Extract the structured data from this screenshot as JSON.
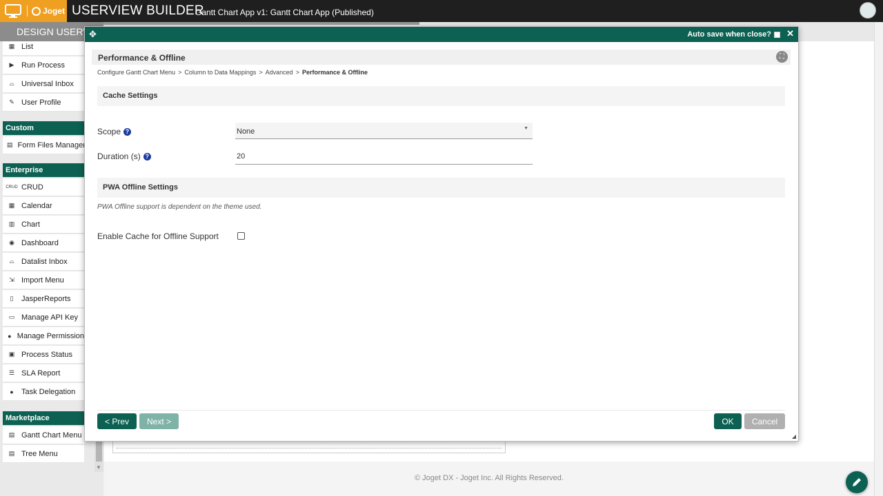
{
  "header": {
    "logo_text": "Joget",
    "title": "USERVIEW BUILDER",
    "subtitle": "Gantt Chart App v1: Gantt Chart App (Published)"
  },
  "subbar": {
    "design_tab": "DESIGN USERVIEW"
  },
  "sidebar": {
    "items_top": [
      {
        "label": "List",
        "icon": "table-icon"
      },
      {
        "label": "Run Process",
        "icon": "play-icon"
      },
      {
        "label": "Universal Inbox",
        "icon": "inbox-icon"
      },
      {
        "label": "User Profile",
        "icon": "user-edit-icon"
      }
    ],
    "custom_heading": "Custom",
    "custom_items": [
      {
        "label": "Form Files Manager",
        "icon": "plugin-icon"
      }
    ],
    "enterprise_heading": "Enterprise",
    "enterprise_items": [
      {
        "label": "CRUD",
        "icon": "crud-icon"
      },
      {
        "label": "Calendar",
        "icon": "calendar-icon"
      },
      {
        "label": "Chart",
        "icon": "chart-icon"
      },
      {
        "label": "Dashboard",
        "icon": "dashboard-icon"
      },
      {
        "label": "Datalist Inbox",
        "icon": "inbox-icon"
      },
      {
        "label": "Import Menu",
        "icon": "import-icon"
      },
      {
        "label": "JasperReports",
        "icon": "report-icon"
      },
      {
        "label": "Manage API Key",
        "icon": "desktop-icon"
      },
      {
        "label": "Manage Permission",
        "icon": "users-icon"
      },
      {
        "label": "Process Status",
        "icon": "status-icon"
      },
      {
        "label": "SLA Report",
        "icon": "list-icon"
      },
      {
        "label": "Task Delegation",
        "icon": "user-task-icon"
      }
    ],
    "marketplace_heading": "Marketplace",
    "marketplace_items": [
      {
        "label": "Gantt Chart Menu",
        "icon": "plugin-icon"
      },
      {
        "label": "Tree Menu",
        "icon": "plugin-icon"
      }
    ]
  },
  "modal": {
    "autosave_label": "Auto save when close?",
    "autosave_checked": false,
    "panel_title": "Performance & Offline",
    "breadcrumb": [
      "Configure Gantt Chart Menu",
      "Column to Data Mappings",
      "Advanced",
      "Performance & Offline"
    ],
    "cache_section": "Cache Settings",
    "scope_label": "Scope",
    "scope_value": "None",
    "duration_label": "Duration (s)",
    "duration_value": "20",
    "pwa_section": "PWA Offline Settings",
    "pwa_note": "PWA Offline support is dependent on the theme used.",
    "offline_label": "Enable Cache for Offline Support",
    "offline_checked": false,
    "buttons": {
      "prev": "< Prev",
      "next": "Next >",
      "ok": "OK",
      "cancel": "Cancel"
    }
  },
  "footer": {
    "copyright": "© Joget DX - Joget Inc. All Rights Reserved."
  },
  "colors": {
    "brand": "#0d6152",
    "logo_orange": "#f0a020",
    "topbar": "#1f1f1f"
  }
}
